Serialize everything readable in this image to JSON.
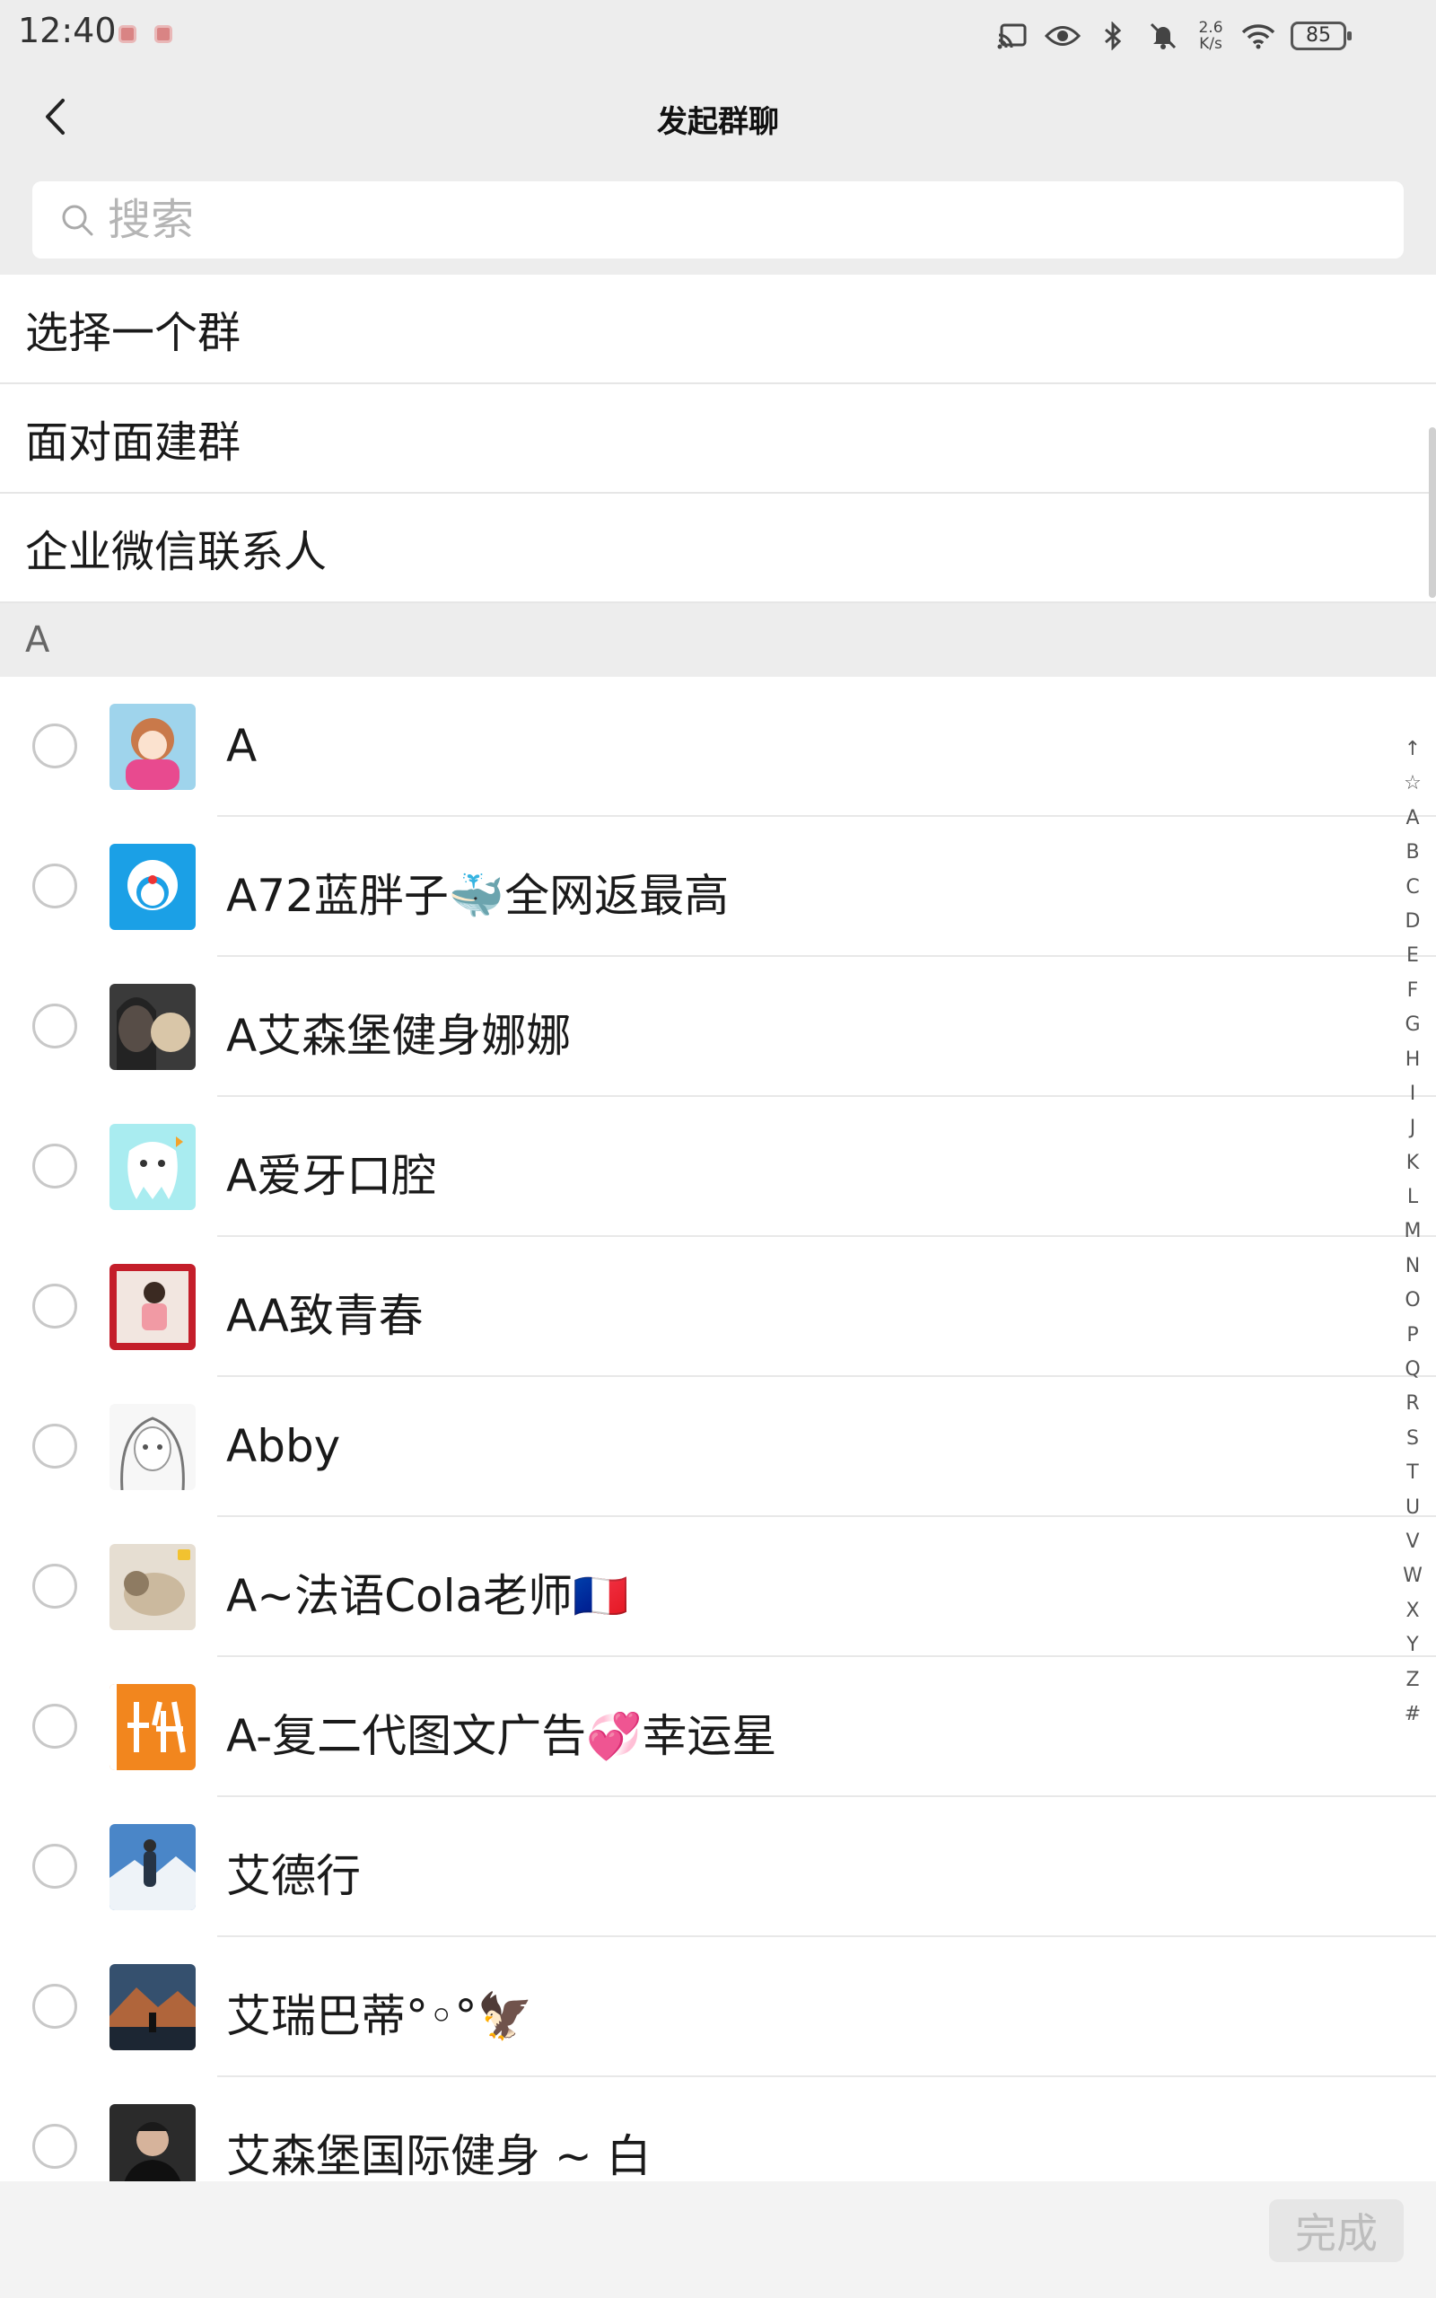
{
  "status_bar": {
    "time": "12:40",
    "network_speed_value": "2.6",
    "network_speed_unit": "K/s",
    "battery": "85",
    "icons": [
      "cast-icon",
      "eye-icon",
      "bluetooth-icon",
      "mute-icon",
      "wifi-icon"
    ]
  },
  "header": {
    "title": "发起群聊",
    "back_icon": "back-chevron-icon"
  },
  "search": {
    "placeholder": "搜索",
    "value": ""
  },
  "menu": [
    {
      "label": "选择一个群"
    },
    {
      "label": "面对面建群"
    },
    {
      "label": "企业微信联系人"
    }
  ],
  "section": {
    "letter": "A"
  },
  "contacts": [
    {
      "name": "A",
      "selected": false,
      "avatar": "anime-girl-avatar"
    },
    {
      "name": "A72蓝胖子🐳全网返最高",
      "selected": false,
      "avatar": "doraemon-avatar"
    },
    {
      "name": "A艾森堡健身娜娜",
      "selected": false,
      "avatar": "girl-with-dog-avatar"
    },
    {
      "name": "A爱牙口腔",
      "selected": false,
      "avatar": "tooth-cartoon-avatar"
    },
    {
      "name": "AA致青春",
      "selected": false,
      "avatar": "girl-photo-avatar"
    },
    {
      "name": "Abby",
      "selected": false,
      "avatar": "sketch-girl-avatar"
    },
    {
      "name": "A~法语Cola老师🇫🇷",
      "selected": false,
      "avatar": "dog-photo-avatar"
    },
    {
      "name": "A-复二代图文广告💞幸运星",
      "selected": false,
      "avatar": "orange-logo-avatar"
    },
    {
      "name": "艾德行",
      "selected": false,
      "avatar": "snow-mountain-avatar"
    },
    {
      "name": "艾瑞巴蒂°◦°🦅",
      "selected": false,
      "avatar": "mountain-sunset-avatar"
    },
    {
      "name": "艾森堡国际健身 ~ 白",
      "selected": false,
      "avatar": "man-portrait-avatar"
    }
  ],
  "index_bar": [
    "↑",
    "☆",
    "A",
    "B",
    "C",
    "D",
    "E",
    "F",
    "G",
    "H",
    "I",
    "J",
    "K",
    "L",
    "M",
    "N",
    "O",
    "P",
    "Q",
    "R",
    "S",
    "T",
    "U",
    "V",
    "W",
    "X",
    "Y",
    "Z",
    "#"
  ],
  "footer": {
    "done_label": "完成"
  },
  "colors": {
    "background": "#ededed",
    "surface": "#ffffff",
    "done_disabled_text": "#bdbdbd"
  }
}
